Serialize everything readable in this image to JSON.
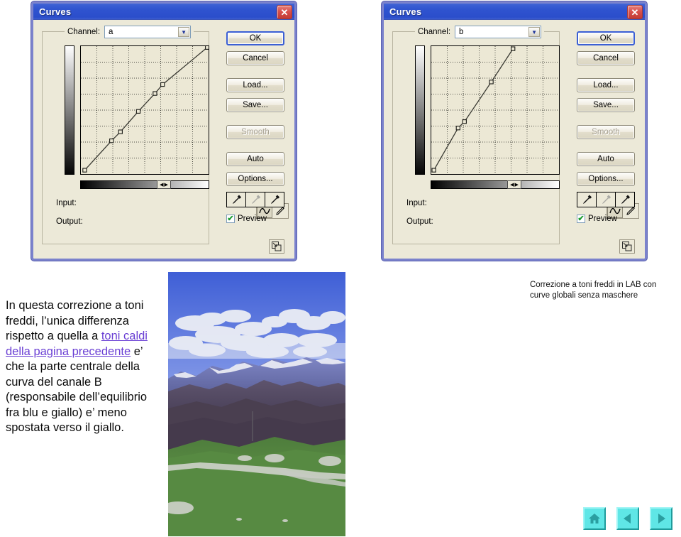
{
  "dialogs": [
    {
      "id": "a",
      "title": "Curves",
      "close_label": "✕",
      "channel_label": "Channel:",
      "channel_value": "a",
      "channel_arrow": "▼",
      "input_label": "Input:",
      "output_label": "Output:",
      "preview_label": "Preview",
      "preview_checked": "✔",
      "buttons": {
        "ok": "OK",
        "cancel": "Cancel",
        "load": "Load...",
        "save": "Save...",
        "smooth": "Smooth",
        "auto": "Auto",
        "options": "Options..."
      },
      "curve": {
        "grid_divisions": 8,
        "points": [
          {
            "x": 0.03,
            "y": 0.03
          },
          {
            "x": 0.24,
            "y": 0.26
          },
          {
            "x": 0.31,
            "y": 0.33
          },
          {
            "x": 0.45,
            "y": 0.49
          },
          {
            "x": 0.58,
            "y": 0.63
          },
          {
            "x": 0.64,
            "y": 0.7
          },
          {
            "x": 0.99,
            "y": 0.99
          }
        ]
      }
    },
    {
      "id": "b",
      "title": "Curves",
      "close_label": "✕",
      "channel_label": "Channel:",
      "channel_value": "b",
      "channel_arrow": "▼",
      "input_label": "Input:",
      "output_label": "Output:",
      "preview_label": "Preview",
      "preview_checked": "✔",
      "buttons": {
        "ok": "OK",
        "cancel": "Cancel",
        "load": "Load...",
        "save": "Save...",
        "smooth": "Smooth",
        "auto": "Auto",
        "options": "Options..."
      },
      "curve": {
        "grid_divisions": 8,
        "points": [
          {
            "x": 0.02,
            "y": 0.03
          },
          {
            "x": 0.21,
            "y": 0.36
          },
          {
            "x": 0.26,
            "y": 0.41
          },
          {
            "x": 0.47,
            "y": 0.72
          },
          {
            "x": 0.64,
            "y": 0.98
          }
        ]
      }
    }
  ],
  "body_text": {
    "line1": "In questa correzione a toni freddi, l’unica differenza rispetto a quella a ",
    "link": "toni caldi della pagina precedente",
    "line2": " e’ che la parte centrale della curva del canale B (responsabile dell’equilibrio fra blu e giallo) e’ meno spostata verso il giallo."
  },
  "caption": "Correzione a toni freddi in LAB con curve globali senza maschere",
  "nav": {
    "home": "home-icon",
    "previous": "previous-icon",
    "next": "next-icon"
  },
  "photo": {
    "description": "Alpine mountain landscape with blue sky, white clouds, snow-capped peaks and a green meadow with a gravel path"
  },
  "colors": {
    "dialog_background": "#ece9d8",
    "dialog_border": "#7b82cc",
    "titlebar": "#2b4ecb",
    "close_button": "#c23a35",
    "link": "#6a3fd4",
    "nav_button": "#5fe6e6",
    "graph_background": "#ece8d5"
  }
}
